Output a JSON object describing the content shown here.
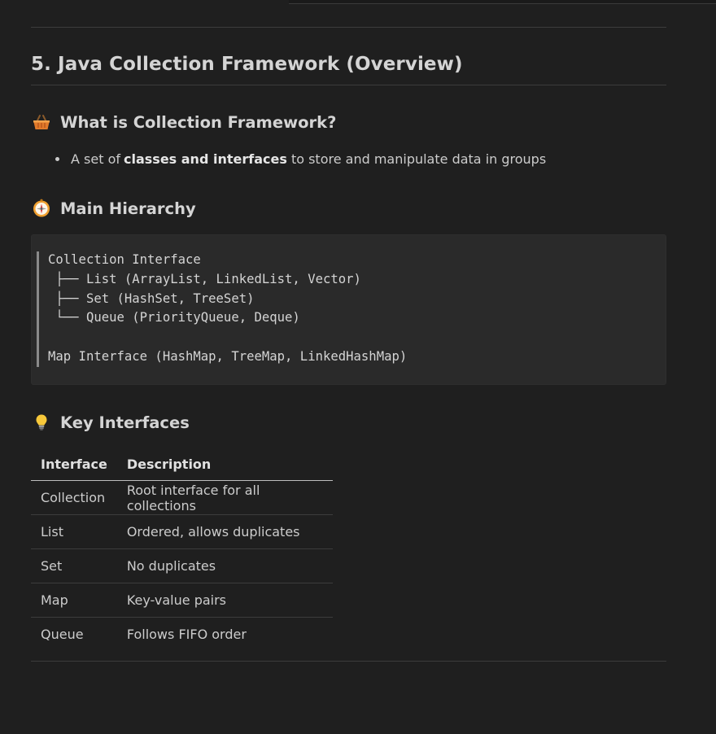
{
  "section": {
    "title": "5. Java Collection Framework (Overview)"
  },
  "what": {
    "heading": "What is Collection Framework?",
    "icon": "basket-icon",
    "bullet": {
      "prefix": "A set of ",
      "bold": "classes and interfaces",
      "suffix": " to store and manipulate data in groups"
    }
  },
  "hierarchy": {
    "heading": "Main Hierarchy",
    "icon": "compass-icon",
    "code": "Collection Interface\n ├── List (ArrayList, LinkedList, Vector)\n ├── Set (HashSet, TreeSet)\n └── Queue (PriorityQueue, Deque)\n\nMap Interface (HashMap, TreeMap, LinkedHashMap)"
  },
  "key": {
    "heading": "Key Interfaces",
    "icon": "lightbulb-icon",
    "columns": [
      "Interface",
      "Description"
    ],
    "rows": [
      [
        "Collection",
        "Root interface for all collections"
      ],
      [
        "List",
        "Ordered, allows duplicates"
      ],
      [
        "Set",
        "No duplicates"
      ],
      [
        "Map",
        "Key-value pairs"
      ],
      [
        "Queue",
        "Follows FIFO order"
      ]
    ]
  },
  "colors": {
    "background": "#1f1f1f",
    "text": "#cccccc",
    "code_background": "#2a2a2a",
    "rule": "#3c3c3c"
  }
}
